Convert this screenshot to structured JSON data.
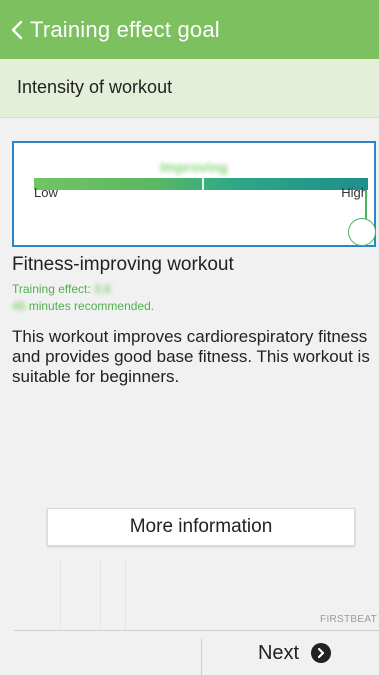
{
  "header": {
    "title": "Training effect goal",
    "back_icon": "chevron-left-icon",
    "color": "#7cc05f"
  },
  "subheader": {
    "title": "Intensity of workout"
  },
  "intensity": {
    "level_label": "Improving",
    "low_label": "Low",
    "high_label": "High",
    "border_color": "#2a86c8"
  },
  "workout": {
    "title": "Fitness-improving workout",
    "training_effect_label": "Training effect:",
    "training_effect_value": "3.8",
    "minutes_value": "45",
    "minutes_label": "minutes recommended.",
    "description": "This workout improves cardiorespiratory fitness and provides good base fitness. This workout is suitable for beginners."
  },
  "buttons": {
    "more_info": "More information",
    "next": "Next",
    "next_icon": "chevron-right-circle-icon"
  },
  "brand": "FIRSTBEAT"
}
